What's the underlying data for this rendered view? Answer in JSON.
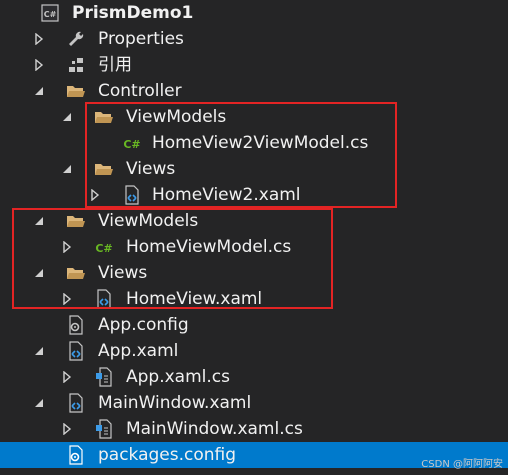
{
  "tree": {
    "project": {
      "label": "PrismDemo1",
      "icon": "csharp-project-icon"
    },
    "items": [
      {
        "label": "Properties",
        "icon": "wrench-icon"
      },
      {
        "label": "引用",
        "icon": "references-icon"
      },
      {
        "label": "Controller",
        "icon": "folder-open-icon"
      },
      {
        "label": "ViewModels",
        "icon": "folder-open-icon"
      },
      {
        "label": "HomeView2ViewModel.cs",
        "icon": "csharp-file-icon"
      },
      {
        "label": "Views",
        "icon": "folder-open-icon"
      },
      {
        "label": "HomeView2.xaml",
        "icon": "xaml-file-icon"
      },
      {
        "label": "ViewModels",
        "icon": "folder-open-icon"
      },
      {
        "label": "HomeViewModel.cs",
        "icon": "csharp-file-icon"
      },
      {
        "label": "Views",
        "icon": "folder-open-icon"
      },
      {
        "label": "HomeView.xaml",
        "icon": "xaml-file-icon"
      },
      {
        "label": "App.config",
        "icon": "config-file-icon"
      },
      {
        "label": "App.xaml",
        "icon": "xaml-file-icon"
      },
      {
        "label": "App.xaml.cs",
        "icon": "code-file-icon"
      },
      {
        "label": "MainWindow.xaml",
        "icon": "xaml-file-icon"
      },
      {
        "label": "MainWindow.xaml.cs",
        "icon": "code-file-icon"
      },
      {
        "label": "packages.config",
        "icon": "config-file-icon",
        "selected": true
      }
    ]
  },
  "watermark": "CSDN @阿阿阿安",
  "colors": {
    "background": "#252526",
    "selection": "#007acc",
    "highlight_border": "#e32424",
    "folder": "#dcb67a",
    "csharp": "#68b723"
  }
}
